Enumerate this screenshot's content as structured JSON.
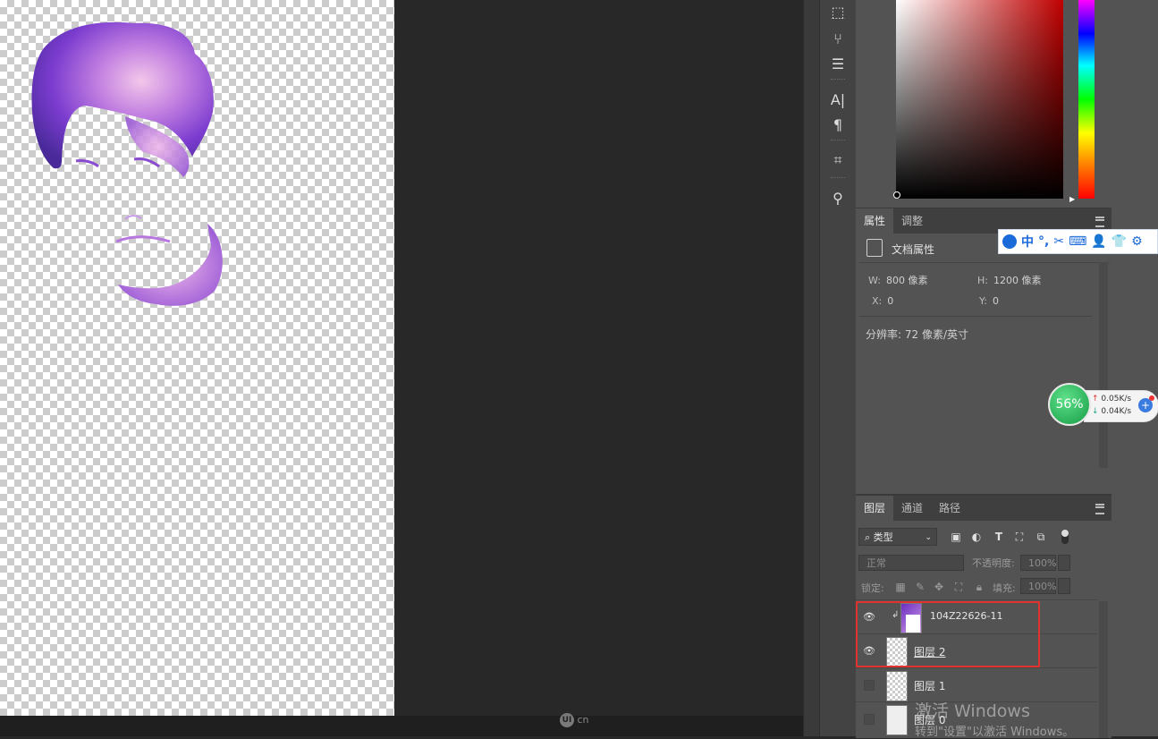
{
  "toolbar": {
    "tools": [
      {
        "name": "path-selection-icon",
        "glyph": "⬚"
      },
      {
        "name": "brush-tools-icon",
        "glyph": "⑂"
      },
      {
        "name": "brush-settings-icon",
        "glyph": "☰"
      },
      {
        "name": "character-icon",
        "glyph": "A|"
      },
      {
        "name": "paragraph-icon",
        "glyph": "¶"
      },
      {
        "name": "crop-icon",
        "glyph": "⌗"
      },
      {
        "name": "stamp-icon",
        "glyph": "⚲"
      }
    ]
  },
  "properties": {
    "tabs": [
      "属性",
      "调整"
    ],
    "doc_label": "文档属性",
    "w_label": "W:",
    "w_value": "800 像素",
    "h_label": "H:",
    "h_value": "1200 像素",
    "x_label": "X:",
    "x_value": "0",
    "y_label": "Y:",
    "y_value": "0",
    "resolution": "分辨率: 72 像素/英寸"
  },
  "layers_panel": {
    "tabs": [
      "图层",
      "通道",
      "路径"
    ],
    "filter_label": "类型",
    "blend_mode": "正常",
    "opacity_label": "不透明度:",
    "opacity_value": "100%",
    "lock_label": "锁定:",
    "fill_label": "填充:",
    "fill_value": "100%",
    "layers": [
      {
        "name": "104Z22626-11",
        "visible": true
      },
      {
        "name": "图层 2",
        "visible": true
      },
      {
        "name": "图层 1",
        "visible": false
      },
      {
        "name": "图层 0",
        "visible": false
      }
    ]
  },
  "ime": {
    "items": [
      "中",
      "°,",
      "✂",
      "⌨",
      "👤",
      "👕",
      "⚙"
    ]
  },
  "network": {
    "percent": "56%",
    "up": "0.05K/s",
    "down": "0.04K/s"
  },
  "watermark": {
    "site": "cn",
    "logo": "UI"
  },
  "os_watermark": {
    "line1": "激活 Windows",
    "line2": "转到\"设置\"以激活 Windows。"
  },
  "colors": {
    "highlight": "#e0332f",
    "panel": "#535353"
  }
}
